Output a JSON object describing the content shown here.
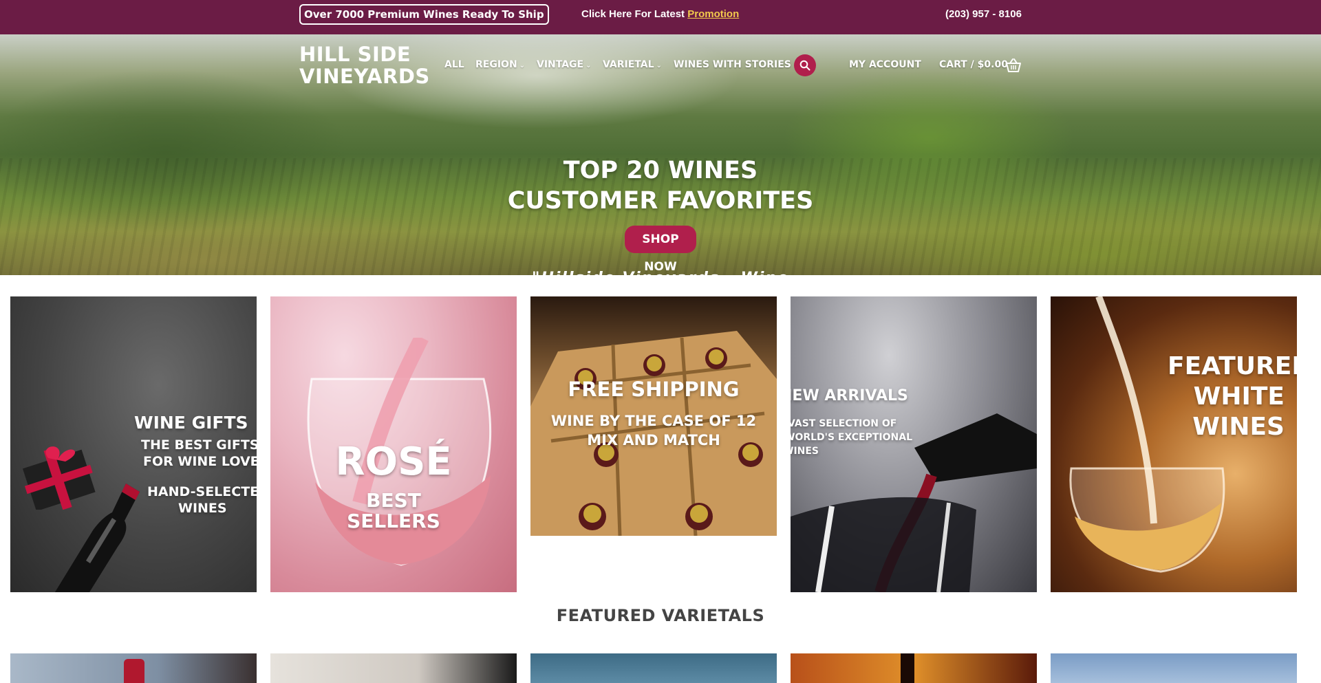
{
  "topbar": {
    "ships_text": "Over 7000 Premium Wines Ready To Ship",
    "promo_prefix": "Click Here For Latest",
    "promo_link": "Promotion",
    "phone": "(203) 957 - 8106"
  },
  "header": {
    "logo_line1": "HILL SIDE",
    "logo_line2": "VINEYARDS",
    "nav": [
      {
        "label": "ALL",
        "dropdown": false
      },
      {
        "label": "REGION",
        "dropdown": true
      },
      {
        "label": "VINTAGE",
        "dropdown": true
      },
      {
        "label": "VARIETAL",
        "dropdown": true
      },
      {
        "label": "WINES WITH STORIES",
        "dropdown": false
      }
    ],
    "account": "MY ACCOUNT",
    "cart": "CART / $0.00",
    "search_icon": "search-icon",
    "cart_icon": "basket-icon"
  },
  "hero": {
    "title_line1": "TOP 20 WINES",
    "title_line2": "CUSTOMER FAVORITES",
    "cta": "SHOP NOW",
    "sub": "\"Hillside Vineyards - Wine Lovers Choice\""
  },
  "tiles": [
    {
      "title": "WINE GIFTS",
      "lines": [
        "THE BEST GIFTS",
        "FOR WINE LOVERS"
      ],
      "extra": [
        "HAND-SELECTED",
        "WINES"
      ]
    },
    {
      "title": "ROSÉ",
      "lines": [
        "BEST",
        "SELLERS"
      ]
    },
    {
      "title": "FREE SHIPPING",
      "lines": [
        "WINE BY THE CASE OF 12",
        "MIX AND MATCH"
      ]
    },
    {
      "title": "NEW ARRIVALS",
      "lines": [
        "VAST SELECTION OF",
        "WORLD'S EXCEPTIONAL",
        "WINES"
      ]
    },
    {
      "title": "FEATURED",
      "lines": [
        "WHITE",
        "WINES"
      ]
    }
  ],
  "featured_varietals": {
    "title": "FEATURED VARIETALS"
  },
  "colors": {
    "topbar_bg": "#6b1c45",
    "accent": "#b01f4c",
    "promo_link": "#f2c94c"
  }
}
